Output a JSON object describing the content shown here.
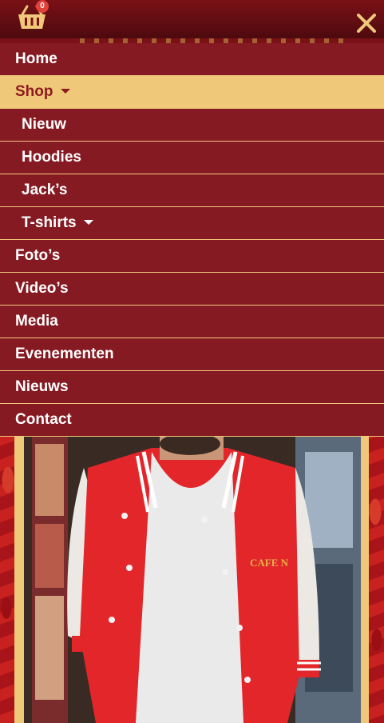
{
  "cart": {
    "count": "0",
    "icon": "basket-icon"
  },
  "close": {
    "icon": "close-icon"
  },
  "menu": {
    "items": [
      {
        "label": "Home",
        "active": false,
        "sub": false,
        "dropdown": false
      },
      {
        "label": "Shop",
        "active": true,
        "sub": false,
        "dropdown": true
      },
      {
        "label": "Nieuw",
        "active": false,
        "sub": true,
        "dropdown": false
      },
      {
        "label": "Hoodies",
        "active": false,
        "sub": true,
        "dropdown": false
      },
      {
        "label": "Jack’s",
        "active": false,
        "sub": true,
        "dropdown": false
      },
      {
        "label": "T-shirts",
        "active": false,
        "sub": true,
        "dropdown": true
      },
      {
        "label": "Foto’s",
        "active": false,
        "sub": false,
        "dropdown": false
      },
      {
        "label": "Video’s",
        "active": false,
        "sub": false,
        "dropdown": false
      },
      {
        "label": "Media",
        "active": false,
        "sub": false,
        "dropdown": false
      },
      {
        "label": "Evenementen",
        "active": false,
        "sub": false,
        "dropdown": false
      },
      {
        "label": "Nieuws",
        "active": false,
        "sub": false,
        "dropdown": false
      },
      {
        "label": "Contact",
        "active": false,
        "sub": false,
        "dropdown": false
      }
    ]
  },
  "product_image": {
    "jacket_print": "CAFE N"
  },
  "colors": {
    "menu_bg": "#861a22",
    "accent": "#f0c87a",
    "active_text": "#8c1b1f",
    "badge": "#e0413a"
  }
}
